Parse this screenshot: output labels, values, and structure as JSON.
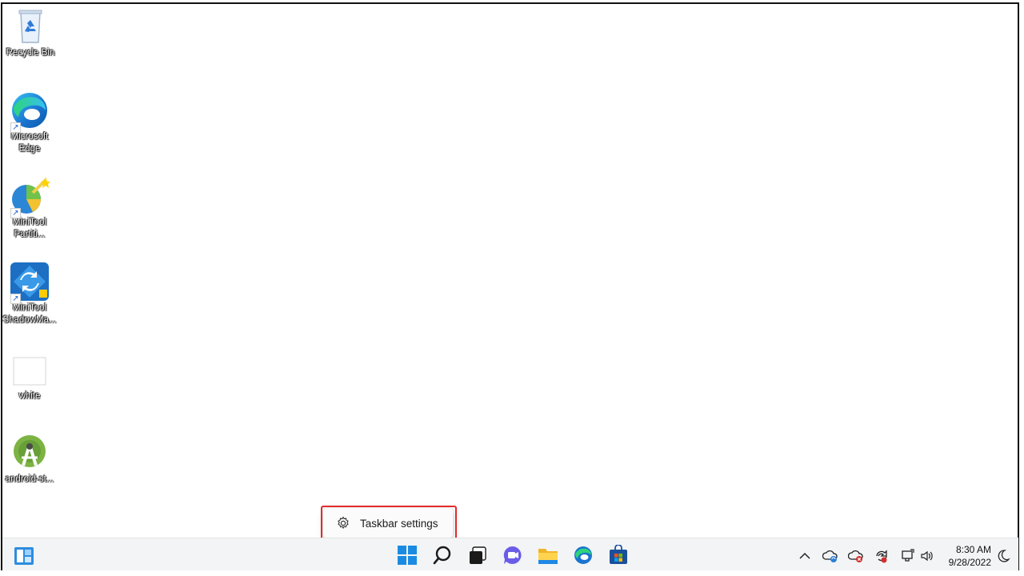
{
  "desktop": {
    "icons": [
      {
        "label": "Recycle Bin",
        "icon": "recycle-bin-icon"
      },
      {
        "label": "Microsoft Edge",
        "icon": "edge-icon"
      },
      {
        "label": "MiniTool Partiti...",
        "icon": "minitool-partition-icon"
      },
      {
        "label": "MiniTool ShadowMa...",
        "icon": "minitool-shadowmaker-icon"
      },
      {
        "label": "white",
        "icon": "blank-file-icon"
      },
      {
        "label": "android-st...",
        "icon": "android-studio-icon"
      }
    ]
  },
  "context_menu": {
    "items": [
      {
        "label": "Taskbar settings",
        "icon": "gear-icon"
      }
    ]
  },
  "taskbar": {
    "apps": [
      "widgets-icon",
      "start-icon",
      "search-icon",
      "task-view-icon",
      "chat-icon",
      "file-explorer-icon",
      "edge-icon",
      "store-icon"
    ],
    "tray": [
      "chevron-up-icon",
      "onedrive-sync-icon",
      "onedrive-error-icon",
      "sync-alert-icon",
      "network-icon",
      "volume-icon",
      "moon-icon"
    ],
    "clock": {
      "time": "8:30 AM",
      "date": "9/28/2022"
    }
  },
  "colors": {
    "highlight": "#e32b2b",
    "taskbar_bg": "#f2f4f5",
    "accent": "#0078d4"
  }
}
